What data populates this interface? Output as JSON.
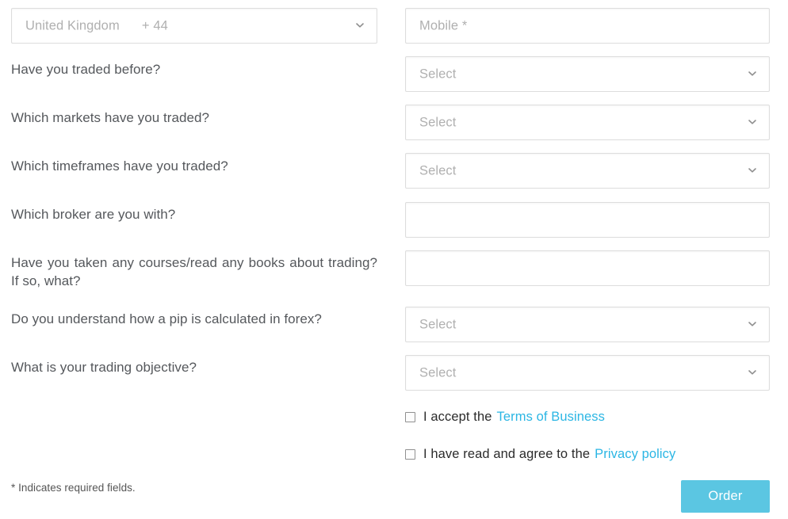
{
  "form": {
    "country_select": {
      "country": "United Kingdom",
      "dial_code": "+ 44",
      "display": "United Kingdom      + 44"
    },
    "mobile_input": {
      "placeholder": "Mobile *",
      "value": ""
    },
    "select_placeholder": "Select",
    "questions": [
      {
        "label": "Have you traded before?",
        "control": "select",
        "value": "Select"
      },
      {
        "label": "Which markets have you traded?",
        "control": "select",
        "value": "Select"
      },
      {
        "label": "Which timeframes have you traded?",
        "control": "select",
        "value": "Select"
      },
      {
        "label": "Which broker are you with?",
        "control": "text",
        "value": ""
      },
      {
        "label": "Have you taken any courses/read any books about trading? If so, what?",
        "control": "text",
        "value": ""
      },
      {
        "label": "Do you understand how a pip is calculated in forex?",
        "control": "select",
        "value": "Select"
      },
      {
        "label": "What is your trading objective?",
        "control": "select",
        "value": "Select"
      }
    ],
    "consents": [
      {
        "text_before": "I accept the",
        "link_text": "Terms of Business",
        "checked": false
      },
      {
        "text_before": "I have read and agree to the",
        "link_text": "Privacy policy",
        "checked": false
      }
    ],
    "required_note": "* Indicates required fields.",
    "submit_label": "Order"
  },
  "colors": {
    "link": "#2bb6e4",
    "button": "#5bc6e2",
    "label_text": "#55585c",
    "placeholder": "#b0b0b0",
    "field_border": "#dddddd"
  }
}
